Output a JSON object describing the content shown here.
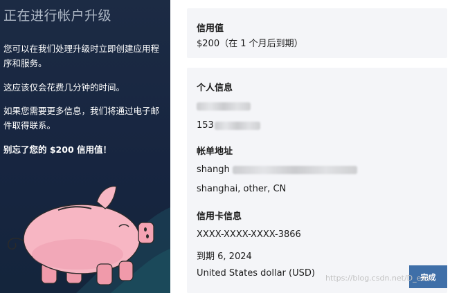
{
  "sidebar": {
    "title": "正在进行帐户升级",
    "paragraphs": [
      "您可以在我们处理升级时立即创建应用程序和服务。",
      "这应该仅会花费几分钟的时间。",
      "如果您需要更多信息，我们将通过电子邮件取得联系。"
    ],
    "highlight": "别忘了您的 $200 信用值！",
    "illustration": "piggy-bank-icon"
  },
  "credit": {
    "label": "信用值",
    "value": "$200（在 1 个月后到期）"
  },
  "personal": {
    "label": "个人信息",
    "phone_prefix": "153"
  },
  "billing": {
    "label": "帐单地址",
    "address_prefix": "shangh",
    "city_line": "shanghai, other, CN"
  },
  "card": {
    "label": "信用卡信息",
    "number": "XXXX-XXXX-XXXX-3866",
    "expiry": "到期 6, 2024",
    "currency": "United States dollar (USD)"
  },
  "actions": {
    "done_label": "完成"
  },
  "watermark": "https://blog.csdn.net/D_east",
  "colors": {
    "sidebar": "#172540",
    "button": "#3f6fa8",
    "card": "#f4f5f8",
    "pig": "#f7b6c3"
  }
}
